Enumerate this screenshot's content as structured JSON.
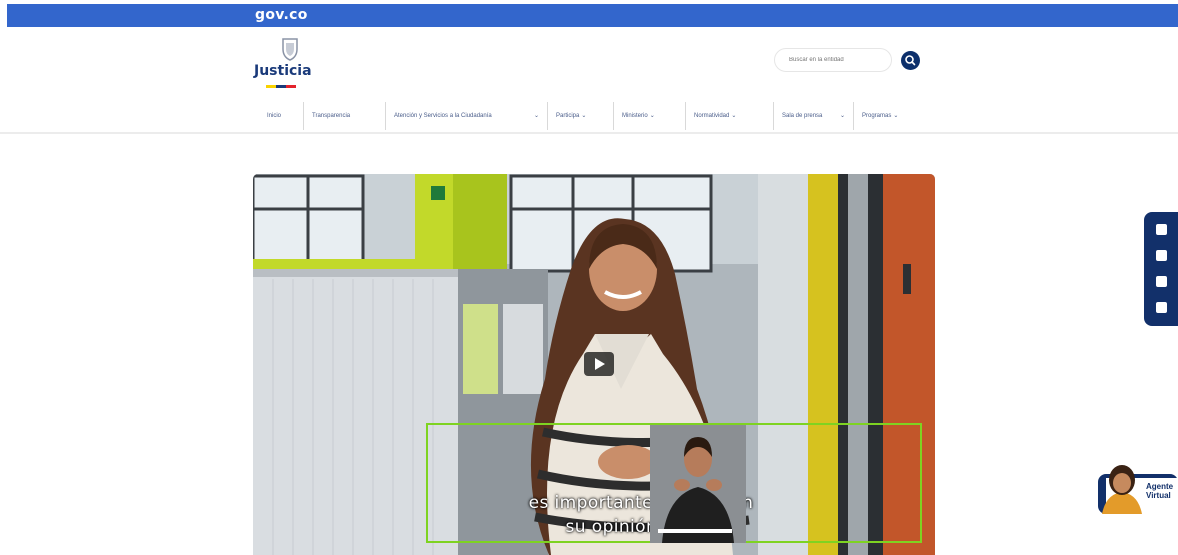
{
  "gov_bar": {
    "logo_text": "gov.co",
    "color": "#3366cc"
  },
  "brand": {
    "name": "Justicia",
    "stripe_colors": [
      "#f9d200",
      "#1a3a7a",
      "#e3232c"
    ]
  },
  "search": {
    "placeholder": "Buscar en la entidad",
    "icon": "search-icon"
  },
  "nav": {
    "items": [
      {
        "label": "Inicio",
        "has_dropdown": false
      },
      {
        "label": "Transparencia",
        "has_dropdown": false
      },
      {
        "label": "Atención y Servicios a la Ciudadanía",
        "has_dropdown": true
      },
      {
        "label": "Participa",
        "has_dropdown": true
      },
      {
        "label": "Ministerio",
        "has_dropdown": true
      },
      {
        "label": "Normatividad",
        "has_dropdown": true
      },
      {
        "label": "Sala de prensa",
        "has_dropdown": true
      },
      {
        "label": "Programas",
        "has_dropdown": true
      }
    ],
    "chevron": "⌄"
  },
  "video": {
    "subtitle_line_1": "es importante contar con",
    "subtitle_line_2": "su opinión con el",
    "play_icon": "play-icon",
    "subtitle_box_color": "#7ed321"
  },
  "accessibility_toolbar": {
    "color": "#12306a",
    "buttons": [
      "contrast-icon",
      "decrease-text-icon",
      "increase-text-icon",
      "sign-language-icon"
    ]
  },
  "virtual_agent": {
    "label_line_1": "Agente",
    "label_line_2": "Virtual"
  }
}
